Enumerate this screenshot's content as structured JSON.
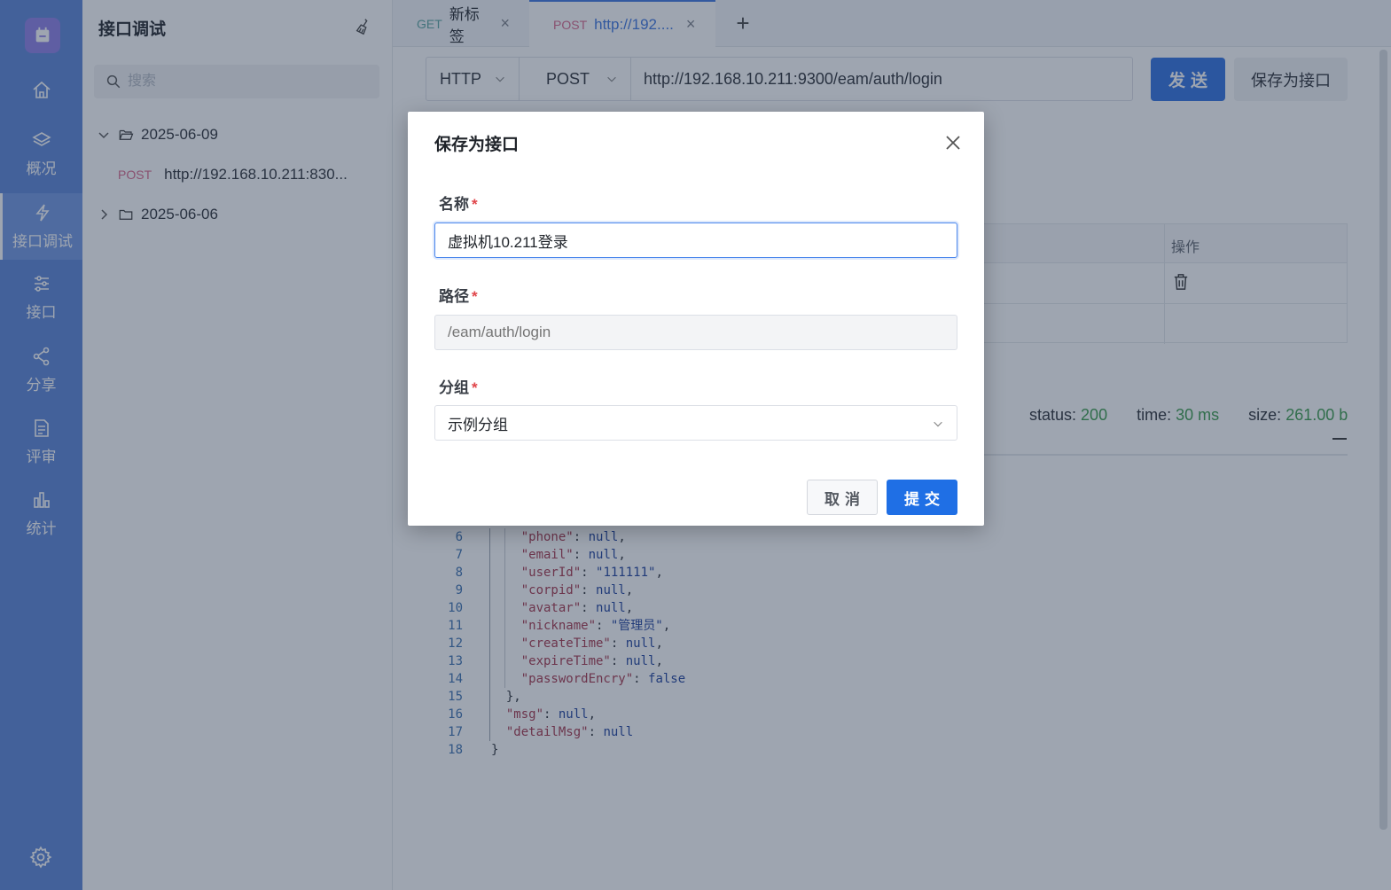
{
  "nav": {
    "items": [
      {
        "label": "",
        "icon": "home-icon"
      },
      {
        "label": "概况",
        "icon": "layers-icon"
      },
      {
        "label": "接口调试",
        "icon": "lightning-icon",
        "active": true
      },
      {
        "label": "接口",
        "icon": "sliders-icon"
      },
      {
        "label": "分享",
        "icon": "share-icon"
      },
      {
        "label": "评审",
        "icon": "document-icon"
      },
      {
        "label": "统计",
        "icon": "bar-chart-icon"
      }
    ],
    "settings_icon": "gear-icon"
  },
  "tree": {
    "title": "接口调试",
    "search_placeholder": "搜索",
    "folders": [
      {
        "name": "2025-06-09",
        "expanded": true
      },
      {
        "name": "2025-06-06",
        "expanded": false
      }
    ],
    "requests": [
      {
        "method": "POST",
        "name": "http://192.168.10.211:830..."
      }
    ]
  },
  "tabs": [
    {
      "method": "GET",
      "title": "新标签",
      "close": "×"
    },
    {
      "method": "POST",
      "title": "http://192....",
      "close": "×",
      "active": true
    }
  ],
  "tab_add": "+",
  "request": {
    "protocol": "HTTP",
    "method": "POST",
    "url": "http://192.168.10.211:9300/eam/auth/login",
    "send_label": "发送",
    "save_label": "保存为接口"
  },
  "params_table": {
    "op_header": "操作"
  },
  "response": {
    "status_label": "status:",
    "status_value": "200",
    "time_label": "time:",
    "time_value": "30 ms",
    "size_label": "size:",
    "size_value": "261.00 b"
  },
  "code_lines": [
    {
      "n": "6",
      "indent": "    ",
      "key": "\"phone\"",
      "val": "null",
      "end": ","
    },
    {
      "n": "7",
      "indent": "    ",
      "key": "\"email\"",
      "val": "null",
      "end": ","
    },
    {
      "n": "8",
      "indent": "    ",
      "key": "\"userId\"",
      "val": "\"111111\"",
      "end": ","
    },
    {
      "n": "9",
      "indent": "    ",
      "key": "\"corpid\"",
      "val": "null",
      "end": ","
    },
    {
      "n": "10",
      "indent": "    ",
      "key": "\"avatar\"",
      "val": "null",
      "end": ","
    },
    {
      "n": "11",
      "indent": "    ",
      "key": "\"nickname\"",
      "val": "\"管理员\"",
      "end": ","
    },
    {
      "n": "12",
      "indent": "    ",
      "key": "\"createTime\"",
      "val": "null",
      "end": ","
    },
    {
      "n": "13",
      "indent": "    ",
      "key": "\"expireTime\"",
      "val": "null",
      "end": ","
    },
    {
      "n": "14",
      "indent": "    ",
      "key": "\"passwordEncry\"",
      "val": "false",
      "end": ""
    },
    {
      "n": "15",
      "indent": "  ",
      "key": "",
      "val": "",
      "end": "},"
    },
    {
      "n": "16",
      "indent": "  ",
      "key": "\"msg\"",
      "val": "null",
      "end": ","
    },
    {
      "n": "17",
      "indent": "  ",
      "key": "\"detailMsg\"",
      "val": "null",
      "end": ""
    },
    {
      "n": "18",
      "indent": "",
      "key": "",
      "val": "",
      "end": "}"
    }
  ],
  "modal": {
    "title": "保存为接口",
    "name_label": "名称",
    "name_value": "虚拟机10.211登录",
    "path_label": "路径",
    "path_placeholder": "/eam/auth/login",
    "group_label": "分组",
    "group_value": "示例分组",
    "required_mark": "*",
    "cancel_label": "取消",
    "submit_label": "提交"
  },
  "colors": {
    "nav_bg": "#5a84d8",
    "primary": "#2f6fe0",
    "post_method": "#d9668a",
    "get_method": "#5aa5a0",
    "success": "#3a9b4a",
    "required": "#e0454a"
  }
}
